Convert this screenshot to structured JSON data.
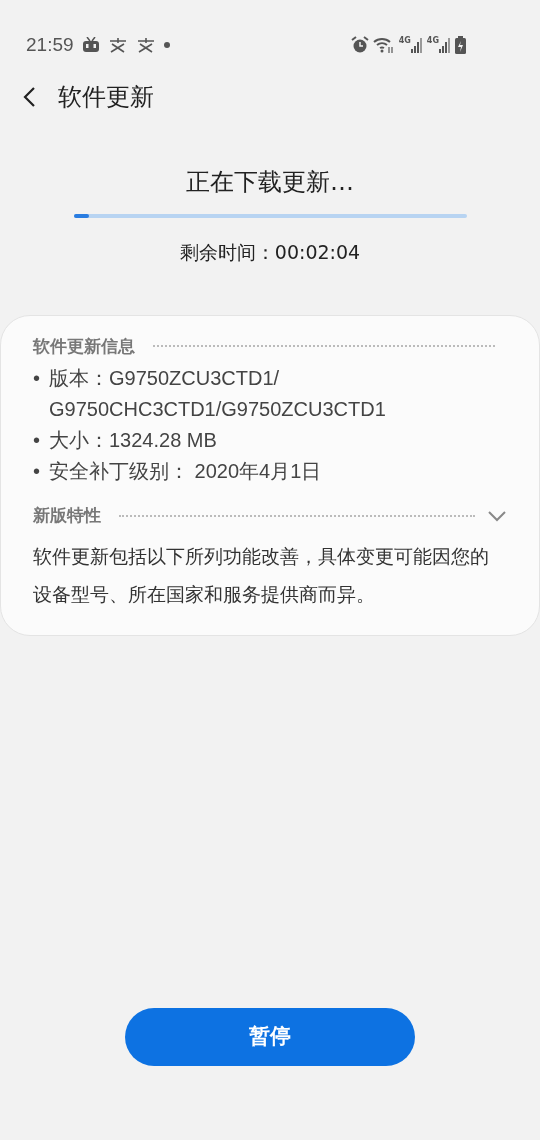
{
  "status_bar": {
    "time": "21:59",
    "network_labels": [
      "4G",
      "4G"
    ]
  },
  "header": {
    "title": "软件更新"
  },
  "download": {
    "status": "正在下载更新…",
    "progress": {
      "level": 0.04
    },
    "remaining": "剩余时间：00:02:04"
  },
  "info": {
    "heading": "软件更新信息",
    "items": [
      {
        "bullet": "•",
        "text": "版本：G9750ZCU3CTD1/ G9750CHC3CTD1/G9750ZCU3CTD1"
      },
      {
        "bullet": "•",
        "text": "大小：1324.28 MB"
      },
      {
        "bullet": "•",
        "text": "安全补丁级别： 2020年4月1日"
      }
    ]
  },
  "features": {
    "heading": "新版特性",
    "expanded": false,
    "text": "软件更新包括以下所列功能改善，具体变更可能因您的设备型号、所在国家和服务提供商而异。"
  },
  "pause_button": {
    "label": "暂停"
  }
}
